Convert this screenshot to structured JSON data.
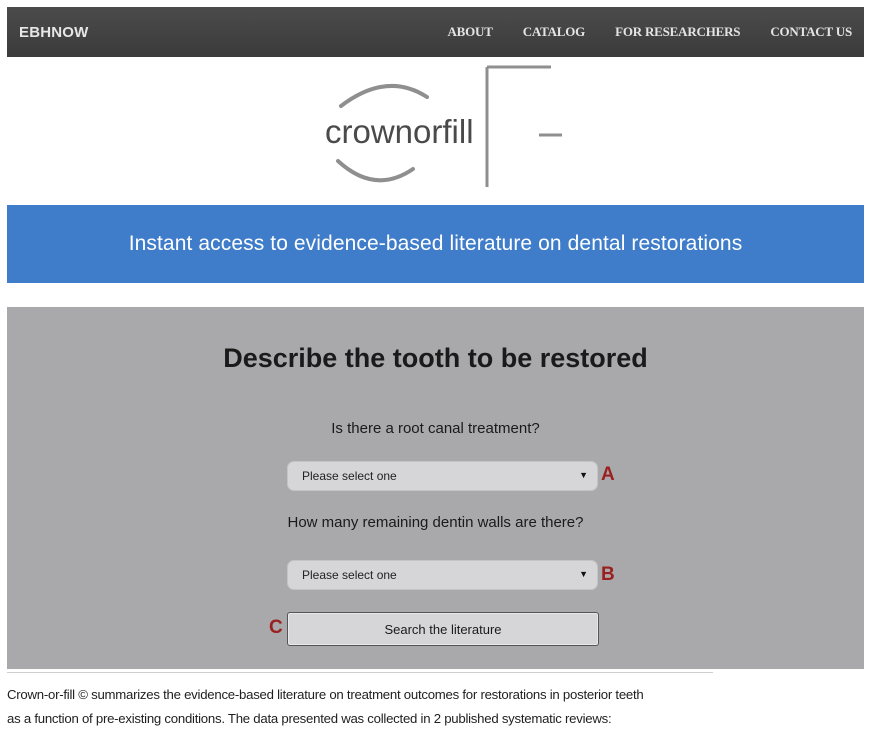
{
  "nav": {
    "brand": "EBHNOW",
    "links": [
      "ABOUT",
      "CATALOG",
      "FOR RESEARCHERS",
      "CONTACT US"
    ]
  },
  "logo": {
    "wordmark": "crownorfill"
  },
  "banner": {
    "text": "Instant access to evidence-based literature on dental restorations"
  },
  "form": {
    "title": "Describe the tooth to be restored",
    "question1": "Is there a root canal treatment?",
    "select1_value": "Please select one",
    "question2": "How many remaining dentin walls are there?",
    "select2_value": "Please select one",
    "search_label": "Search the literature"
  },
  "markers": {
    "a": "A",
    "b": "B",
    "c": "C"
  },
  "footer": {
    "line1": "Crown-or-fill © summarizes the evidence-based literature on treatment outcomes for restorations in posterior teeth",
    "line2": "as a function of pre-existing conditions. The data presented was collected in 2 published systematic reviews:"
  },
  "icons": {
    "select_caret": "caret-down-icon"
  },
  "colors": {
    "navbar": "#434343",
    "banner": "#3f7cc9",
    "form_background": "#a9a9ab",
    "marker": "#9a1f1f"
  }
}
